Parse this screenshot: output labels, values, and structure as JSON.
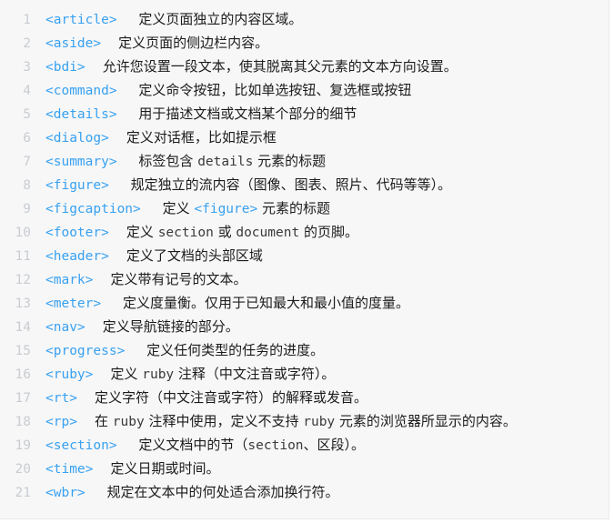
{
  "code_block": {
    "language": "html",
    "colors": {
      "background": "#f7f7f8",
      "line_number": "#c9ccd1",
      "tag": "#38a1f0",
      "text": "#1c1c1c",
      "inline_code": "#3a3a3a",
      "border": "#e9e9ea"
    },
    "lines": [
      {
        "number": "1",
        "tokens": [
          {
            "type": "tag",
            "text": "<article>"
          },
          {
            "type": "text",
            "text": "     定义页面独立的内容区域。"
          }
        ]
      },
      {
        "number": "2",
        "tokens": [
          {
            "type": "tag",
            "text": "<aside>"
          },
          {
            "type": "text",
            "text": "    定义页面的侧边栏内容。"
          }
        ]
      },
      {
        "number": "3",
        "tokens": [
          {
            "type": "tag",
            "text": "<bdi>"
          },
          {
            "type": "text",
            "text": "    允许您设置一段文本，使其脱离其父元素的文本方向设置。"
          }
        ]
      },
      {
        "number": "4",
        "tokens": [
          {
            "type": "tag",
            "text": "<command>"
          },
          {
            "type": "text",
            "text": "     定义命令按钮，比如单选按钮、复选框或按钮"
          }
        ]
      },
      {
        "number": "5",
        "tokens": [
          {
            "type": "tag",
            "text": "<details>"
          },
          {
            "type": "text",
            "text": "     用于描述文档或文档某个部分的细节"
          }
        ]
      },
      {
        "number": "6",
        "tokens": [
          {
            "type": "tag",
            "text": "<dialog>"
          },
          {
            "type": "text",
            "text": "    定义对话框，比如提示框"
          }
        ]
      },
      {
        "number": "7",
        "tokens": [
          {
            "type": "tag",
            "text": "<summary>"
          },
          {
            "type": "text",
            "text": "     标签包含 "
          },
          {
            "type": "code",
            "text": "details"
          },
          {
            "type": "text",
            "text": " 元素的标题"
          }
        ]
      },
      {
        "number": "8",
        "tokens": [
          {
            "type": "tag",
            "text": "<figure>"
          },
          {
            "type": "text",
            "text": "     规定独立的流内容（图像、图表、照片、代码等等）。"
          }
        ]
      },
      {
        "number": "9",
        "tokens": [
          {
            "type": "tag",
            "text": "<figcaption>"
          },
          {
            "type": "text",
            "text": "     定义 "
          },
          {
            "type": "tag",
            "text": "<figure>"
          },
          {
            "type": "text",
            "text": " 元素的标题"
          }
        ]
      },
      {
        "number": "10",
        "tokens": [
          {
            "type": "tag",
            "text": "<footer>"
          },
          {
            "type": "text",
            "text": "    定义 "
          },
          {
            "type": "code",
            "text": "section"
          },
          {
            "type": "text",
            "text": " 或 "
          },
          {
            "type": "code",
            "text": "document"
          },
          {
            "type": "text",
            "text": " 的页脚。"
          }
        ]
      },
      {
        "number": "11",
        "tokens": [
          {
            "type": "tag",
            "text": "<header>"
          },
          {
            "type": "text",
            "text": "    定义了文档的头部区域"
          }
        ]
      },
      {
        "number": "12",
        "tokens": [
          {
            "type": "tag",
            "text": "<mark>"
          },
          {
            "type": "text",
            "text": "    定义带有记号的文本。"
          }
        ]
      },
      {
        "number": "13",
        "tokens": [
          {
            "type": "tag",
            "text": "<meter>"
          },
          {
            "type": "text",
            "text": "     定义度量衡。仅用于已知最大和最小值的度量。"
          }
        ]
      },
      {
        "number": "14",
        "tokens": [
          {
            "type": "tag",
            "text": "<nav>"
          },
          {
            "type": "text",
            "text": "    定义导航链接的部分。"
          }
        ]
      },
      {
        "number": "15",
        "tokens": [
          {
            "type": "tag",
            "text": "<progress>"
          },
          {
            "type": "text",
            "text": "     定义任何类型的任务的进度。"
          }
        ]
      },
      {
        "number": "16",
        "tokens": [
          {
            "type": "tag",
            "text": "<ruby>"
          },
          {
            "type": "text",
            "text": "    定义 "
          },
          {
            "type": "code",
            "text": "ruby"
          },
          {
            "type": "text",
            "text": " 注释（中文注音或字符）。"
          }
        ]
      },
      {
        "number": "17",
        "tokens": [
          {
            "type": "tag",
            "text": "<rt>"
          },
          {
            "type": "text",
            "text": "    定义字符（中文注音或字符）的解释或发音。"
          }
        ]
      },
      {
        "number": "18",
        "tokens": [
          {
            "type": "tag",
            "text": "<rp>"
          },
          {
            "type": "text",
            "text": "    在 "
          },
          {
            "type": "code",
            "text": "ruby"
          },
          {
            "type": "text",
            "text": " 注释中使用，定义不支持 "
          },
          {
            "type": "code",
            "text": "ruby"
          },
          {
            "type": "text",
            "text": " 元素的浏览器所显示的内容。"
          }
        ]
      },
      {
        "number": "19",
        "tokens": [
          {
            "type": "tag",
            "text": "<section>"
          },
          {
            "type": "text",
            "text": "     定义文档中的节（"
          },
          {
            "type": "code",
            "text": "section"
          },
          {
            "type": "text",
            "text": "、区段）。"
          }
        ]
      },
      {
        "number": "20",
        "tokens": [
          {
            "type": "tag",
            "text": "<time>"
          },
          {
            "type": "text",
            "text": "    定义日期或时间。"
          }
        ]
      },
      {
        "number": "21",
        "tokens": [
          {
            "type": "tag",
            "text": "<wbr>"
          },
          {
            "type": "text",
            "text": "     规定在文本中的何处适合添加换行符。"
          }
        ]
      }
    ]
  }
}
